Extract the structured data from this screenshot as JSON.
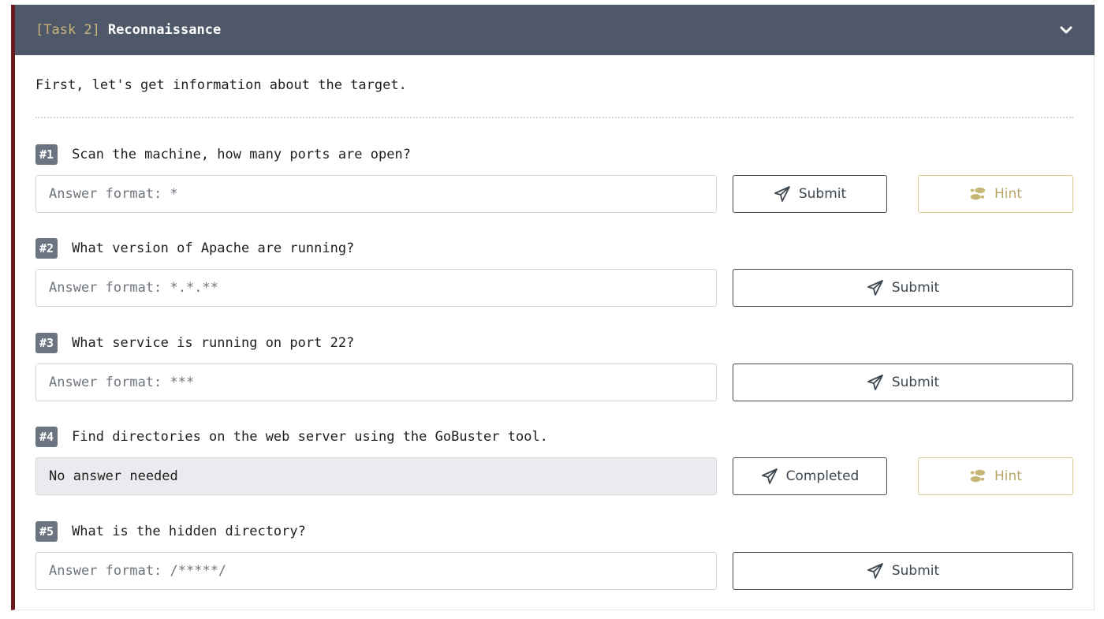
{
  "task": {
    "tag": "[Task 2]",
    "title": "Reconnaissance",
    "intro": "First, let's get information about the target."
  },
  "questions": [
    {
      "number": "#1",
      "text": "Scan the machine, how many ports are open?",
      "placeholder": "Answer format: *",
      "submit_label": "Submit",
      "hint_label": "Hint"
    },
    {
      "number": "#2",
      "text": "What version of Apache are running?",
      "placeholder": "Answer format: *.*.**",
      "submit_label": "Submit"
    },
    {
      "number": "#3",
      "text": "What service is running on port 22?",
      "placeholder": "Answer format: ***",
      "submit_label": "Submit"
    },
    {
      "number": "#4",
      "text": "Find directories on the web server using the GoBuster tool.",
      "value": "No answer needed",
      "submit_label": "Completed",
      "hint_label": "Hint"
    },
    {
      "number": "#5",
      "text": "What is the hidden directory?",
      "placeholder": "Answer format: /*****/",
      "submit_label": "Submit"
    }
  ],
  "icons": {
    "collapse": "chevron-down-icon",
    "submit": "paper-plane-icon",
    "hint": "footprints-icon"
  },
  "colors": {
    "header_bg": "#4f5869",
    "accent_bar": "#6b1a1f",
    "task_tag": "#c9b27a",
    "hint": "#b8a66a",
    "badge_bg": "#6b7480"
  }
}
